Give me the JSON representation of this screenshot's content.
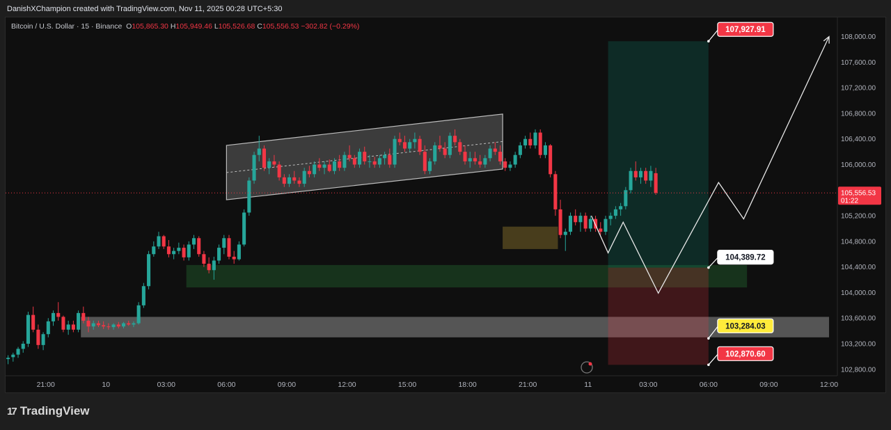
{
  "header": {
    "attribution": "DanishXChampion created with TradingView.com, Nov 11, 2025 00:28 UTC+5:30"
  },
  "legend": {
    "symbol": "Bitcoin / U.S. Dollar · 15 · Binance",
    "o_label": "O",
    "o_value": "105,865.30",
    "h_label": "H",
    "h_value": "105,949.46",
    "l_label": "L",
    "l_value": "105,526.68",
    "c_label": "C",
    "c_value": "105,556.53",
    "change": "−302.82 (−0.29%)"
  },
  "brand": {
    "name": "TradingView",
    "logo_glyph": "17"
  },
  "colors": {
    "up": "#26a69a",
    "down": "#f23645",
    "target": "#f23645",
    "entry": "#ffffff",
    "flip": "#ffeb3b"
  },
  "chart_data": {
    "type": "candlestick",
    "title": "Bitcoin / U.S. Dollar · 15 · Binance",
    "ylim": [
      102700,
      108300
    ],
    "y_ticks": [
      "102,800.00",
      "103,200.00",
      "103,600.00",
      "104,000.00",
      "104,400.00",
      "104,800.00",
      "105,200.00",
      "105,600.00",
      "106,000.00",
      "106,400.00",
      "106,800.00",
      "107,200.00",
      "107,600.00",
      "108,000.00"
    ],
    "y_tick_values": [
      102800,
      103200,
      103600,
      104000,
      104400,
      104800,
      105200,
      105600,
      106000,
      106400,
      106800,
      107200,
      107600,
      108000
    ],
    "x_ticks": [
      {
        "label": "21:00",
        "t": "2025-11-09 21:00"
      },
      {
        "label": "10",
        "t": "2025-11-10 00:00"
      },
      {
        "label": "03:00",
        "t": "2025-11-10 03:00"
      },
      {
        "label": "06:00",
        "t": "2025-11-10 06:00"
      },
      {
        "label": "09:00",
        "t": "2025-11-10 09:00"
      },
      {
        "label": "12:00",
        "t": "2025-11-10 12:00"
      },
      {
        "label": "15:00",
        "t": "2025-11-10 15:00"
      },
      {
        "label": "18:00",
        "t": "2025-11-10 18:00"
      },
      {
        "label": "21:00",
        "t": "2025-11-10 21:00"
      },
      {
        "label": "11",
        "t": "2025-11-11 00:00"
      },
      {
        "label": "03:00",
        "t": "2025-11-11 03:00"
      },
      {
        "label": "06:00",
        "t": "2025-11-11 06:00"
      },
      {
        "label": "09:00",
        "t": "2025-11-11 09:00"
      },
      {
        "label": "12:00",
        "t": "2025-11-11 12:00"
      }
    ],
    "x_range": [
      "2025-11-09 19:00",
      "2025-11-11 12:25"
    ],
    "candle_start": "2025-11-09 19:00",
    "candle_interval_minutes": 15,
    "candles": [
      [
        102960,
        103020,
        102880,
        102980
      ],
      [
        102990,
        103060,
        102920,
        103030
      ],
      [
        103030,
        103150,
        102980,
        103120
      ],
      [
        103120,
        103240,
        103060,
        103200
      ],
      [
        103200,
        103700,
        103150,
        103650
      ],
      [
        103650,
        103780,
        103380,
        103420
      ],
      [
        103420,
        103500,
        103120,
        103180
      ],
      [
        103180,
        103380,
        103100,
        103350
      ],
      [
        103350,
        103600,
        103300,
        103550
      ],
      [
        103550,
        103720,
        103480,
        103680
      ],
      [
        103680,
        103850,
        103560,
        103620
      ],
      [
        103620,
        103640,
        103380,
        103420
      ],
      [
        103420,
        103560,
        103340,
        103500
      ],
      [
        103500,
        103560,
        103380,
        103420
      ],
      [
        103420,
        103720,
        103380,
        103680
      ],
      [
        103680,
        103780,
        103520,
        103560
      ],
      [
        103560,
        103620,
        103380,
        103470
      ],
      [
        103470,
        103560,
        103420,
        103520
      ],
      [
        103520,
        103560,
        103460,
        103490
      ],
      [
        103490,
        103550,
        103430,
        103470
      ],
      [
        103470,
        103520,
        103420,
        103460
      ],
      [
        103460,
        103520,
        103420,
        103500
      ],
      [
        103500,
        103540,
        103440,
        103470
      ],
      [
        103470,
        103540,
        103440,
        103520
      ],
      [
        103520,
        103560,
        103480,
        103500
      ],
      [
        103500,
        103550,
        103460,
        103520
      ],
      [
        103520,
        103850,
        103500,
        103800
      ],
      [
        103800,
        104150,
        103760,
        104100
      ],
      [
        104100,
        104650,
        104050,
        104600
      ],
      [
        104600,
        104800,
        104560,
        104720
      ],
      [
        104720,
        104950,
        104680,
        104880
      ],
      [
        104880,
        104900,
        104680,
        104720
      ],
      [
        104720,
        104820,
        104550,
        104600
      ],
      [
        104600,
        104700,
        104520,
        104650
      ],
      [
        104650,
        104780,
        104600,
        104700
      ],
      [
        104700,
        104750,
        104500,
        104550
      ],
      [
        104550,
        104800,
        104500,
        104750
      ],
      [
        104750,
        104900,
        104680,
        104850
      ],
      [
        104850,
        104880,
        104560,
        104600
      ],
      [
        104600,
        104650,
        104400,
        104450
      ],
      [
        104450,
        104550,
        104300,
        104350
      ],
      [
        104350,
        104560,
        104200,
        104500
      ],
      [
        104500,
        104750,
        104450,
        104700
      ],
      [
        104700,
        104900,
        104600,
        104850
      ],
      [
        104850,
        104900,
        104520,
        104560
      ],
      [
        104560,
        104650,
        104450,
        104520
      ],
      [
        104520,
        104800,
        104500,
        104750
      ],
      [
        104750,
        105300,
        104720,
        105250
      ],
      [
        105250,
        105800,
        105200,
        105750
      ],
      [
        105750,
        106200,
        105700,
        106150
      ],
      [
        106150,
        106450,
        106050,
        106250
      ],
      [
        106250,
        106300,
        105900,
        105950
      ],
      [
        105950,
        106100,
        105850,
        106050
      ],
      [
        106050,
        106150,
        105950,
        106000
      ],
      [
        106000,
        106050,
        105750,
        105800
      ],
      [
        105800,
        105850,
        105650,
        105700
      ],
      [
        105700,
        105850,
        105650,
        105800
      ],
      [
        105800,
        105900,
        105700,
        105750
      ],
      [
        105750,
        105800,
        105650,
        105700
      ],
      [
        105700,
        105950,
        105650,
        105900
      ],
      [
        105900,
        105980,
        105800,
        105850
      ],
      [
        105850,
        106050,
        105800,
        106000
      ],
      [
        106000,
        106100,
        105900,
        105950
      ],
      [
        105950,
        106050,
        105850,
        106000
      ],
      [
        106000,
        106080,
        105880,
        105900
      ],
      [
        105900,
        106100,
        105850,
        106050
      ],
      [
        106050,
        106150,
        105900,
        105950
      ],
      [
        105950,
        106200,
        105900,
        106150
      ],
      [
        106150,
        106300,
        106050,
        106100
      ],
      [
        106100,
        106150,
        105950,
        106000
      ],
      [
        106000,
        106250,
        105950,
        106200
      ],
      [
        106200,
        106280,
        106000,
        106050
      ],
      [
        106050,
        106150,
        105950,
        106050
      ],
      [
        106050,
        106120,
        105950,
        106000
      ],
      [
        106000,
        106150,
        105950,
        106100
      ],
      [
        106100,
        106200,
        106000,
        106150
      ],
      [
        106150,
        106250,
        105950,
        106000
      ],
      [
        106000,
        106450,
        105950,
        106400
      ],
      [
        106400,
        106500,
        106300,
        106350
      ],
      [
        106350,
        106450,
        106200,
        106250
      ],
      [
        106250,
        106400,
        106200,
        106350
      ],
      [
        106350,
        106500,
        106250,
        106400
      ],
      [
        106400,
        106450,
        106150,
        106200
      ],
      [
        106200,
        106300,
        105850,
        105900
      ],
      [
        105900,
        106100,
        105850,
        106050
      ],
      [
        106050,
        106350,
        106000,
        106300
      ],
      [
        106300,
        106450,
        106200,
        106250
      ],
      [
        106250,
        106350,
        106100,
        106150
      ],
      [
        106150,
        106500,
        106100,
        106450
      ],
      [
        106450,
        106550,
        106300,
        106350
      ],
      [
        106350,
        106400,
        106150,
        106200
      ],
      [
        106200,
        106300,
        106000,
        106050
      ],
      [
        106050,
        106200,
        105950,
        106100
      ],
      [
        106100,
        106200,
        106000,
        106050
      ],
      [
        106050,
        106150,
        105950,
        106000
      ],
      [
        106000,
        106150,
        105950,
        106100
      ],
      [
        106100,
        106300,
        106050,
        106250
      ],
      [
        106250,
        106350,
        106150,
        106200
      ],
      [
        106200,
        106300,
        106000,
        106050
      ],
      [
        106050,
        106100,
        105900,
        105950
      ],
      [
        105950,
        106050,
        105900,
        106000
      ],
      [
        106000,
        106200,
        105950,
        106150
      ],
      [
        106150,
        106350,
        106100,
        106300
      ],
      [
        106300,
        106450,
        106250,
        106400
      ],
      [
        106400,
        106500,
        106250,
        106300
      ],
      [
        106300,
        106550,
        106250,
        106500
      ],
      [
        106500,
        106550,
        106100,
        106150
      ],
      [
        106150,
        106350,
        106100,
        106300
      ],
      [
        106300,
        106320,
        105800,
        105850
      ],
      [
        105850,
        105900,
        105200,
        105300
      ],
      [
        105300,
        105450,
        104850,
        104900
      ],
      [
        104900,
        105000,
        104650,
        104950
      ],
      [
        104950,
        105250,
        104900,
        105200
      ],
      [
        105200,
        105300,
        105050,
        105100
      ],
      [
        105100,
        105250,
        104950,
        105200
      ],
      [
        105200,
        105250,
        104950,
        105000
      ],
      [
        105000,
        105200,
        104950,
        105150
      ],
      [
        105150,
        105200,
        104950,
        105000
      ],
      [
        105000,
        105100,
        104900,
        104950
      ],
      [
        104950,
        105200,
        104900,
        105150
      ],
      [
        105150,
        105250,
        105050,
        105200
      ],
      [
        105200,
        105350,
        105150,
        105300
      ],
      [
        105300,
        105400,
        105200,
        105350
      ],
      [
        105350,
        105650,
        105300,
        105600
      ],
      [
        105600,
        105950,
        105550,
        105900
      ],
      [
        105900,
        106050,
        105750,
        105800
      ],
      [
        105800,
        105950,
        105700,
        105900
      ],
      [
        105900,
        105950,
        105700,
        105750
      ],
      [
        105750,
        105980,
        105650,
        105900
      ],
      [
        105865,
        105949,
        105527,
        105557
      ]
    ],
    "zones": [
      {
        "name": "demand-zone-green",
        "y0": 104080,
        "y1": 104430,
        "from": "2025-11-10 04:00",
        "to": "2025-11-11 07:55"
      },
      {
        "name": "support-zone-gray",
        "y0": 103300,
        "y1": 103620,
        "from": "2025-11-09 22:45",
        "to": "2025-11-11 12:00"
      },
      {
        "name": "retest-box-brown",
        "y0": 104680,
        "y1": 105030,
        "from": "2025-11-10 19:45",
        "to": "2025-11-10 22:30"
      },
      {
        "name": "channel-bottom-highlight",
        "y0": 105380,
        "y1": 105420,
        "from": "2025-11-10 06:00",
        "to": "2025-11-10 06:15"
      }
    ],
    "channel": {
      "lower": [
        [
          "2025-11-10 06:00",
          105450
        ],
        [
          "2025-11-10 19:45",
          105930
        ]
      ],
      "upper": [
        [
          "2025-11-10 06:00",
          106300
        ],
        [
          "2025-11-10 19:45",
          106790
        ]
      ]
    },
    "position": {
      "from": "2025-11-11 01:00",
      "to": "2025-11-11 06:00",
      "entry": 104389.72,
      "target": 107927.91,
      "stop": 102870.6
    },
    "projection": [
      [
        "2025-11-11 00:10",
        105200
      ],
      [
        "2025-11-11 01:00",
        104620
      ],
      [
        "2025-11-11 01:45",
        105100
      ],
      [
        "2025-11-11 03:30",
        103990
      ],
      [
        "2025-11-11 06:30",
        105720
      ],
      [
        "2025-11-11 07:45",
        105150
      ],
      [
        "2025-11-11 12:00",
        108000
      ]
    ],
    "price_labels": [
      {
        "value": "107,927.91",
        "price": 107927.91,
        "style": "target"
      },
      {
        "value": "104,389.72",
        "price": 104389.72,
        "style": "entry"
      },
      {
        "value": "103,284.03",
        "price": 103284.03,
        "style": "flip"
      },
      {
        "value": "102,870.60",
        "price": 102870.6,
        "style": "target"
      }
    ],
    "current_price": {
      "value": "105,556.53",
      "countdown": "01:22",
      "price": 105556.53
    }
  }
}
